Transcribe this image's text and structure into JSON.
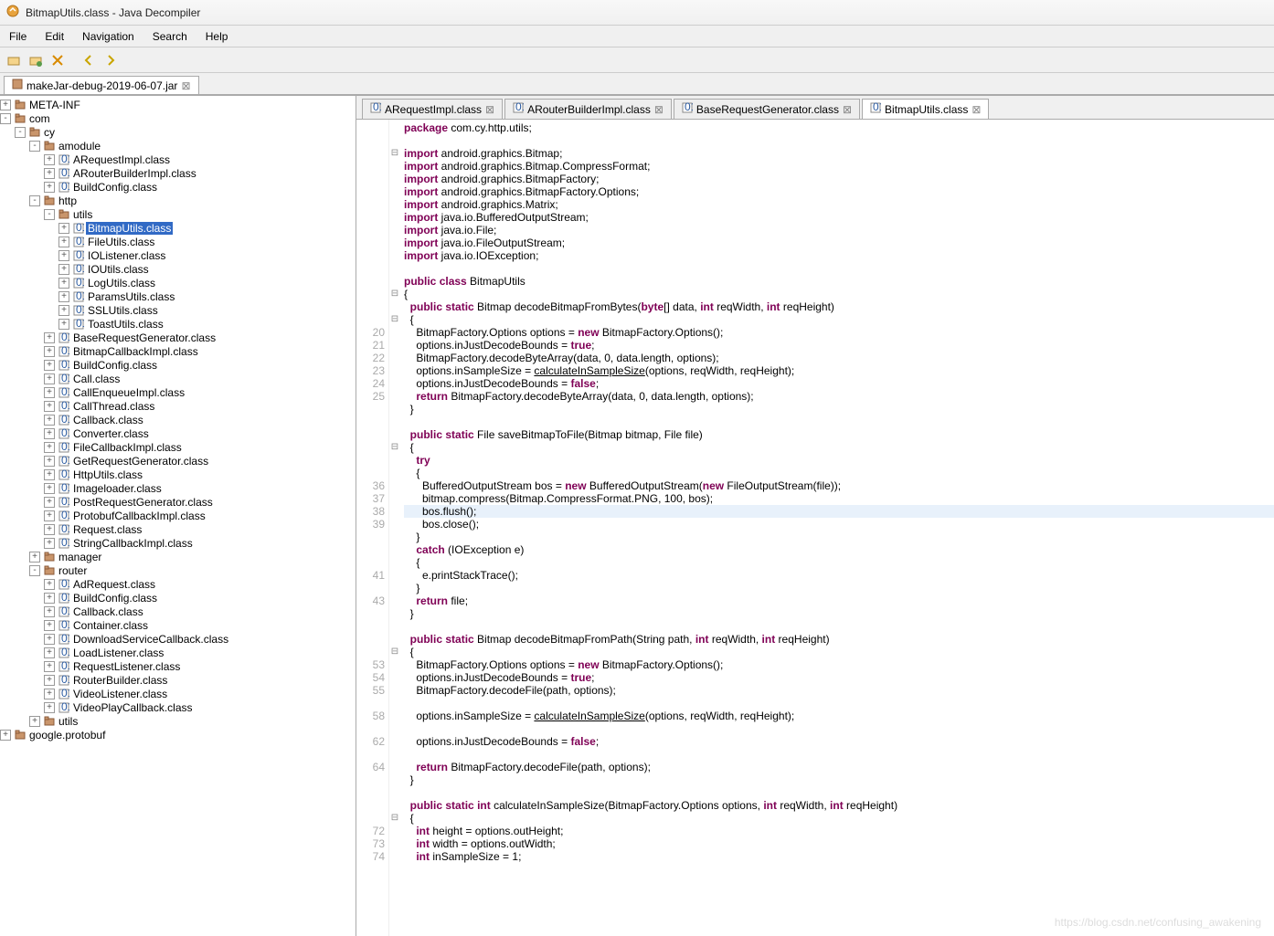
{
  "window": {
    "title": "BitmapUtils.class - Java Decompiler"
  },
  "menu": [
    "File",
    "Edit",
    "Navigation",
    "Search",
    "Help"
  ],
  "jar_tab": {
    "label": "makeJar-debug-2019-06-07.jar",
    "close": "⊠"
  },
  "tree": [
    {
      "d": 0,
      "ex": "+",
      "t": "pkg",
      "label": "META-INF"
    },
    {
      "d": 0,
      "ex": "-",
      "t": "pkg",
      "label": "com"
    },
    {
      "d": 1,
      "ex": "-",
      "t": "pkg",
      "label": "cy"
    },
    {
      "d": 2,
      "ex": "-",
      "t": "pkg",
      "label": "amodule"
    },
    {
      "d": 3,
      "ex": "+",
      "t": "cls",
      "label": "ARequestImpl.class"
    },
    {
      "d": 3,
      "ex": "+",
      "t": "cls",
      "label": "ARouterBuilderImpl.class"
    },
    {
      "d": 3,
      "ex": "+",
      "t": "cls",
      "label": "BuildConfig.class"
    },
    {
      "d": 2,
      "ex": "-",
      "t": "pkg",
      "label": "http"
    },
    {
      "d": 3,
      "ex": "-",
      "t": "pkg",
      "label": "utils"
    },
    {
      "d": 4,
      "ex": "+",
      "t": "cls",
      "label": "BitmapUtils.class",
      "sel": true
    },
    {
      "d": 4,
      "ex": "+",
      "t": "cls",
      "label": "FileUtils.class"
    },
    {
      "d": 4,
      "ex": "+",
      "t": "cls",
      "label": "IOListener.class"
    },
    {
      "d": 4,
      "ex": "+",
      "t": "cls",
      "label": "IOUtils.class"
    },
    {
      "d": 4,
      "ex": "+",
      "t": "cls",
      "label": "LogUtils.class"
    },
    {
      "d": 4,
      "ex": "+",
      "t": "cls",
      "label": "ParamsUtils.class"
    },
    {
      "d": 4,
      "ex": "+",
      "t": "cls",
      "label": "SSLUtils.class"
    },
    {
      "d": 4,
      "ex": "+",
      "t": "cls",
      "label": "ToastUtils.class"
    },
    {
      "d": 3,
      "ex": "+",
      "t": "cls",
      "label": "BaseRequestGenerator.class"
    },
    {
      "d": 3,
      "ex": "+",
      "t": "cls",
      "label": "BitmapCallbackImpl.class"
    },
    {
      "d": 3,
      "ex": "+",
      "t": "cls",
      "label": "BuildConfig.class"
    },
    {
      "d": 3,
      "ex": "+",
      "t": "cls",
      "label": "Call.class"
    },
    {
      "d": 3,
      "ex": "+",
      "t": "cls",
      "label": "CallEnqueueImpl.class"
    },
    {
      "d": 3,
      "ex": "+",
      "t": "cls",
      "label": "CallThread.class"
    },
    {
      "d": 3,
      "ex": "+",
      "t": "cls",
      "label": "Callback.class"
    },
    {
      "d": 3,
      "ex": "+",
      "t": "cls",
      "label": "Converter.class"
    },
    {
      "d": 3,
      "ex": "+",
      "t": "cls",
      "label": "FileCallbackImpl.class"
    },
    {
      "d": 3,
      "ex": "+",
      "t": "cls",
      "label": "GetRequestGenerator.class"
    },
    {
      "d": 3,
      "ex": "+",
      "t": "cls",
      "label": "HttpUtils.class"
    },
    {
      "d": 3,
      "ex": "+",
      "t": "cls",
      "label": "Imageloader.class"
    },
    {
      "d": 3,
      "ex": "+",
      "t": "cls",
      "label": "PostRequestGenerator.class"
    },
    {
      "d": 3,
      "ex": "+",
      "t": "cls",
      "label": "ProtobufCallbackImpl.class"
    },
    {
      "d": 3,
      "ex": "+",
      "t": "cls",
      "label": "Request.class"
    },
    {
      "d": 3,
      "ex": "+",
      "t": "cls",
      "label": "StringCallbackImpl.class"
    },
    {
      "d": 2,
      "ex": "+",
      "t": "pkg",
      "label": "manager"
    },
    {
      "d": 2,
      "ex": "-",
      "t": "pkg",
      "label": "router"
    },
    {
      "d": 3,
      "ex": "+",
      "t": "cls",
      "label": "AdRequest.class"
    },
    {
      "d": 3,
      "ex": "+",
      "t": "cls",
      "label": "BuildConfig.class"
    },
    {
      "d": 3,
      "ex": "+",
      "t": "cls",
      "label": "Callback.class"
    },
    {
      "d": 3,
      "ex": "+",
      "t": "cls",
      "label": "Container.class"
    },
    {
      "d": 3,
      "ex": "+",
      "t": "cls",
      "label": "DownloadServiceCallback.class"
    },
    {
      "d": 3,
      "ex": "+",
      "t": "cls",
      "label": "LoadListener.class"
    },
    {
      "d": 3,
      "ex": "+",
      "t": "cls",
      "label": "RequestListener.class"
    },
    {
      "d": 3,
      "ex": "+",
      "t": "cls",
      "label": "RouterBuilder.class"
    },
    {
      "d": 3,
      "ex": "+",
      "t": "cls",
      "label": "VideoListener.class"
    },
    {
      "d": 3,
      "ex": "+",
      "t": "cls",
      "label": "VideoPlayCallback.class"
    },
    {
      "d": 2,
      "ex": "+",
      "t": "pkg",
      "label": "utils"
    },
    {
      "d": 0,
      "ex": "+",
      "t": "pkg",
      "label": "google.protobuf"
    }
  ],
  "editor_tabs": [
    {
      "label": "ARequestImpl.class"
    },
    {
      "label": "ARouterBuilderImpl.class"
    },
    {
      "label": "BaseRequestGenerator.class"
    },
    {
      "label": "BitmapUtils.class",
      "active": true
    }
  ],
  "code": [
    {
      "n": "",
      "f": "",
      "html": "<span class='kw'>package</span> com.cy.http.utils;"
    },
    {
      "n": "",
      "f": "",
      "html": ""
    },
    {
      "n": "",
      "f": "-",
      "html": "<span class='kw'>import</span> android.graphics.Bitmap;"
    },
    {
      "n": "",
      "f": "",
      "html": "<span class='kw'>import</span> android.graphics.Bitmap.CompressFormat;"
    },
    {
      "n": "",
      "f": "",
      "html": "<span class='kw'>import</span> android.graphics.BitmapFactory;"
    },
    {
      "n": "",
      "f": "",
      "html": "<span class='kw'>import</span> android.graphics.BitmapFactory.Options;"
    },
    {
      "n": "",
      "f": "",
      "html": "<span class='kw'>import</span> android.graphics.Matrix;"
    },
    {
      "n": "",
      "f": "",
      "html": "<span class='kw'>import</span> java.io.BufferedOutputStream;"
    },
    {
      "n": "",
      "f": "",
      "html": "<span class='kw'>import</span> java.io.File;"
    },
    {
      "n": "",
      "f": "",
      "html": "<span class='kw'>import</span> java.io.FileOutputStream;"
    },
    {
      "n": "",
      "f": "",
      "html": "<span class='kw'>import</span> java.io.IOException;"
    },
    {
      "n": "",
      "f": "",
      "html": ""
    },
    {
      "n": "",
      "f": "",
      "html": "<span class='kw'>public</span> <span class='kw'>class</span> BitmapUtils"
    },
    {
      "n": "",
      "f": "-",
      "html": "{"
    },
    {
      "n": "",
      "f": "",
      "html": "  <span class='kw'>public</span> <span class='kw'>static</span> Bitmap decodeBitmapFromBytes(<span class='kw'>byte</span>[] data, <span class='kw'>int</span> reqWidth, <span class='kw'>int</span> reqHeight)"
    },
    {
      "n": "",
      "f": "-",
      "html": "  {"
    },
    {
      "n": "20",
      "f": "",
      "html": "    BitmapFactory.Options options = <span class='kw'>new</span> BitmapFactory.Options();"
    },
    {
      "n": "21",
      "f": "",
      "html": "    options.inJustDecodeBounds = <span class='kw'>true</span>;"
    },
    {
      "n": "22",
      "f": "",
      "html": "    BitmapFactory.decodeByteArray(data, 0, data.length, options);"
    },
    {
      "n": "23",
      "f": "",
      "html": "    options.inSampleSize = <span class='under'>calculateInSampleSize</span>(options, reqWidth, reqHeight);"
    },
    {
      "n": "24",
      "f": "",
      "html": "    options.inJustDecodeBounds = <span class='kw'>false</span>;"
    },
    {
      "n": "25",
      "f": "",
      "html": "    <span class='kw'>return</span> BitmapFactory.decodeByteArray(data, 0, data.length, options);"
    },
    {
      "n": "",
      "f": "",
      "html": "  }"
    },
    {
      "n": "",
      "f": "",
      "html": ""
    },
    {
      "n": "",
      "f": "",
      "html": "  <span class='kw'>public</span> <span class='kw'>static</span> File saveBitmapToFile(Bitmap bitmap, File file)"
    },
    {
      "n": "",
      "f": "-",
      "html": "  {"
    },
    {
      "n": "",
      "f": "",
      "html": "    <span class='kw'>try</span>"
    },
    {
      "n": "",
      "f": "",
      "html": "    {"
    },
    {
      "n": "36",
      "f": "",
      "html": "      BufferedOutputStream bos = <span class='kw'>new</span> BufferedOutputStream(<span class='kw'>new</span> FileOutputStream(file));"
    },
    {
      "n": "37",
      "f": "",
      "html": "      bitmap.compress(Bitmap.CompressFormat.PNG, 100, bos);"
    },
    {
      "n": "38",
      "f": "",
      "hl": true,
      "html": "      bos.flush();"
    },
    {
      "n": "39",
      "f": "",
      "html": "      bos.close();"
    },
    {
      "n": "",
      "f": "",
      "html": "    }"
    },
    {
      "n": "",
      "f": "",
      "html": "    <span class='kw'>catch</span> (IOException e)"
    },
    {
      "n": "",
      "f": "",
      "html": "    {"
    },
    {
      "n": "41",
      "f": "",
      "html": "      e.printStackTrace();"
    },
    {
      "n": "",
      "f": "",
      "html": "    }"
    },
    {
      "n": "43",
      "f": "",
      "html": "    <span class='kw'>return</span> file;"
    },
    {
      "n": "",
      "f": "",
      "html": "  }"
    },
    {
      "n": "",
      "f": "",
      "html": ""
    },
    {
      "n": "",
      "f": "",
      "html": "  <span class='kw'>public</span> <span class='kw'>static</span> Bitmap decodeBitmapFromPath(String path, <span class='kw'>int</span> reqWidth, <span class='kw'>int</span> reqHeight)"
    },
    {
      "n": "",
      "f": "-",
      "html": "  {"
    },
    {
      "n": "53",
      "f": "",
      "html": "    BitmapFactory.Options options = <span class='kw'>new</span> BitmapFactory.Options();"
    },
    {
      "n": "54",
      "f": "",
      "html": "    options.inJustDecodeBounds = <span class='kw'>true</span>;"
    },
    {
      "n": "55",
      "f": "",
      "html": "    BitmapFactory.decodeFile(path, options);"
    },
    {
      "n": "",
      "f": "",
      "html": ""
    },
    {
      "n": "58",
      "f": "",
      "html": "    options.inSampleSize = <span class='under'>calculateInSampleSize</span>(options, reqWidth, reqHeight);"
    },
    {
      "n": "",
      "f": "",
      "html": ""
    },
    {
      "n": "62",
      "f": "",
      "html": "    options.inJustDecodeBounds = <span class='kw'>false</span>;"
    },
    {
      "n": "",
      "f": "",
      "html": ""
    },
    {
      "n": "64",
      "f": "",
      "html": "    <span class='kw'>return</span> BitmapFactory.decodeFile(path, options);"
    },
    {
      "n": "",
      "f": "",
      "html": "  }"
    },
    {
      "n": "",
      "f": "",
      "html": ""
    },
    {
      "n": "",
      "f": "",
      "html": "  <span class='kw'>public</span> <span class='kw'>static</span> <span class='kw'>int</span> calculateInSampleSize(BitmapFactory.Options options, <span class='kw'>int</span> reqWidth, <span class='kw'>int</span> reqHeight)"
    },
    {
      "n": "",
      "f": "-",
      "html": "  {"
    },
    {
      "n": "72",
      "f": "",
      "html": "    <span class='kw'>int</span> height = options.outHeight;"
    },
    {
      "n": "73",
      "f": "",
      "html": "    <span class='kw'>int</span> width = options.outWidth;"
    },
    {
      "n": "74",
      "f": "",
      "html": "    <span class='kw'>int</span> inSampleSize = 1;"
    }
  ],
  "watermark": "https://blog.csdn.net/confusing_awakening"
}
